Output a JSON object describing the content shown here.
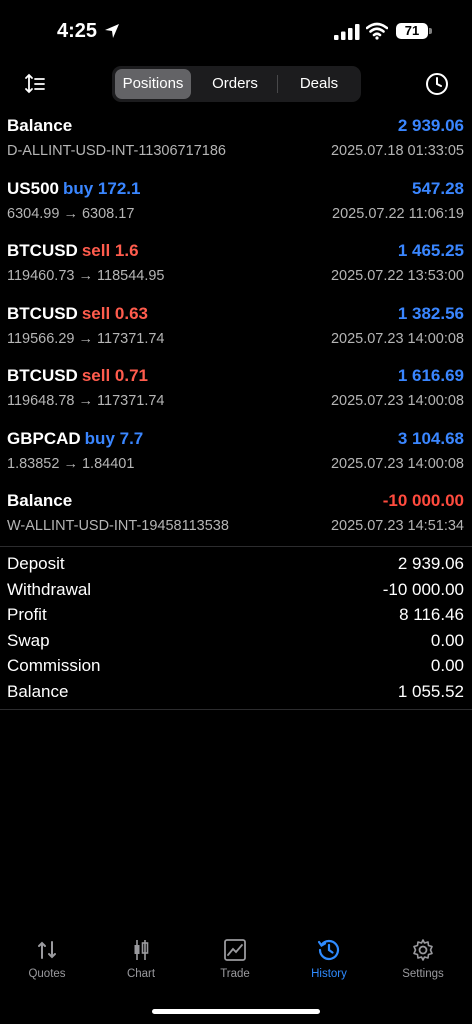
{
  "status": {
    "time": "4:25",
    "battery": "71"
  },
  "toolbar": {
    "tabs": [
      "Positions",
      "Orders",
      "Deals"
    ],
    "active_tab": "Positions"
  },
  "deals": [
    {
      "symbol": "Balance",
      "side": "",
      "side_type": "",
      "detail": "D-ALLINT-USD-INT-11306717186",
      "amount": "2 939.06",
      "amount_type": "pos",
      "date": "2025.07.18 01:33:05"
    },
    {
      "symbol": "US500",
      "side": "buy 172.1",
      "side_type": "buy",
      "detail": "6304.99 → 6308.17",
      "amount": "547.28",
      "amount_type": "pos",
      "date": "2025.07.22 11:06:19"
    },
    {
      "symbol": "BTCUSD",
      "side": "sell 1.6",
      "side_type": "sell",
      "detail": "119460.73 → 118544.95",
      "amount": "1 465.25",
      "amount_type": "pos",
      "date": "2025.07.22 13:53:00"
    },
    {
      "symbol": "BTCUSD",
      "side": "sell 0.63",
      "side_type": "sell",
      "detail": "119566.29 → 117371.74",
      "amount": "1 382.56",
      "amount_type": "pos",
      "date": "2025.07.23 14:00:08"
    },
    {
      "symbol": "BTCUSD",
      "side": "sell 0.71",
      "side_type": "sell",
      "detail": "119648.78 → 117371.74",
      "amount": "1 616.69",
      "amount_type": "pos",
      "date": "2025.07.23 14:00:08"
    },
    {
      "symbol": "GBPCAD",
      "side": "buy 7.7",
      "side_type": "buy",
      "detail": "1.83852 → 1.84401",
      "amount": "3 104.68",
      "amount_type": "pos",
      "date": "2025.07.23 14:00:08"
    },
    {
      "symbol": "Balance",
      "side": "",
      "side_type": "",
      "detail": "W-ALLINT-USD-INT-19458113538",
      "amount": "-10 000.00",
      "amount_type": "neg",
      "date": "2025.07.23 14:51:34"
    }
  ],
  "summary": [
    {
      "label": "Deposit",
      "value": "2 939.06"
    },
    {
      "label": "Withdrawal",
      "value": "-10 000.00"
    },
    {
      "label": "Profit",
      "value": "8 116.46"
    },
    {
      "label": "Swap",
      "value": "0.00"
    },
    {
      "label": "Commission",
      "value": "0.00"
    },
    {
      "label": "Balance",
      "value": "1 055.52"
    }
  ],
  "tabbar": {
    "items": [
      {
        "label": "Quotes",
        "icon": "quotes-icon"
      },
      {
        "label": "Chart",
        "icon": "candlestick-icon"
      },
      {
        "label": "Trade",
        "icon": "trade-chart-icon"
      },
      {
        "label": "History",
        "icon": "history-icon"
      },
      {
        "label": "Settings",
        "icon": "gear-icon"
      }
    ],
    "active": "History"
  },
  "colors": {
    "accent": "#2f8bff",
    "positive": "#3a86ff",
    "negative": "#ff4b3e",
    "sell": "#ff5c4d"
  }
}
